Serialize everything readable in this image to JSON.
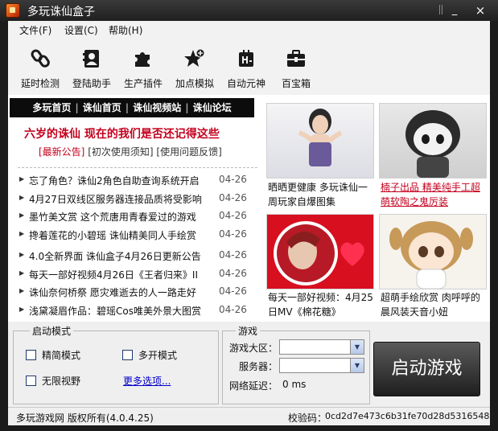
{
  "window": {
    "title": "多玩诛仙盒子",
    "minimize_glyph": "_",
    "close_glyph": "×"
  },
  "menu": [
    {
      "label": "文件(F)"
    },
    {
      "label": "设置(C)"
    },
    {
      "label": "帮助(H)"
    }
  ],
  "toolbar": [
    {
      "label": "延时检测",
      "icon": "link-icon"
    },
    {
      "label": "登陆助手",
      "icon": "contacts-icon"
    },
    {
      "label": "生产插件",
      "icon": "puzzle-icon"
    },
    {
      "label": "加点模拟",
      "icon": "star-plus-icon"
    },
    {
      "label": "自动元神",
      "icon": "auto-icon"
    },
    {
      "label": "百宝箱",
      "icon": "toolbox-icon"
    }
  ],
  "news": {
    "nav": [
      "多玩首页",
      "诛仙首页",
      "诛仙视频站",
      "诛仙论坛"
    ],
    "nav_sep": "|",
    "headline": "六岁的诛仙 现在的我们是否还记得这些",
    "sublinks": [
      "[最新公告]",
      "[初次使用须知]",
      "[使用问题反馈]"
    ],
    "items_a": [
      {
        "title": "忘了角色？诛仙2角色自助查询系统开启",
        "date": "04-26"
      },
      {
        "title": "4月27日双线区服务器连接品质将受影响",
        "date": "04-26"
      },
      {
        "title": "墨竹美文赏 这个荒唐用青春爱过的游戏",
        "date": "04-26"
      },
      {
        "title": "搀着莲花的小碧瑶 诛仙精美同人手绘赏",
        "date": "04-26"
      }
    ],
    "items_b": [
      {
        "title": "4.0全新界面 诛仙盒子4月26日更新公告",
        "date": "04-26"
      },
      {
        "title": "每天一部好视频4月26日《王者归来》II",
        "date": "04-26"
      },
      {
        "title": "诛仙奈何桥祭 愿灾难逝去的人一路走好",
        "date": "04-26"
      },
      {
        "title": "浅黛凝眉作品：碧瑶Cos唯美外景大图赏",
        "date": "04-26"
      }
    ]
  },
  "pictures": [
    {
      "caption": "晒晒更健康 多玩诛仙一周玩家自爆图集",
      "highlight": false
    },
    {
      "caption": "楠子出品 精美纯手工超萌软陶之鬼厉装",
      "highlight": true
    },
    {
      "caption": "每天一部好视频：4月25日MV《棉花糖》",
      "highlight": false
    },
    {
      "caption": "超萌手绘欣赏 肉呼呼的晨风装天音小妞",
      "highlight": false
    }
  ],
  "launch_mode": {
    "group_title": "启动模式",
    "options": [
      "精简模式",
      "多开模式",
      "无限视野"
    ],
    "more_link": "更多选项..."
  },
  "game": {
    "group_title": "游戏",
    "region_label": "游戏大区：",
    "region_value": "",
    "server_label": "服务器：",
    "server_value": "",
    "latency_label": "网络延迟：",
    "latency_value": "0 ms",
    "start_button": "启动游戏"
  },
  "status": {
    "copyright": "多玩游戏网 版权所有(4.0.4.25)",
    "checksum_label": "校验码：",
    "checksum": "0cd2d7e473c6b31fe70d28d5316548"
  },
  "colors": {
    "accent_red": "#c4001d",
    "title_bar": "#2a2a2a",
    "link_blue": "#0000cc"
  }
}
